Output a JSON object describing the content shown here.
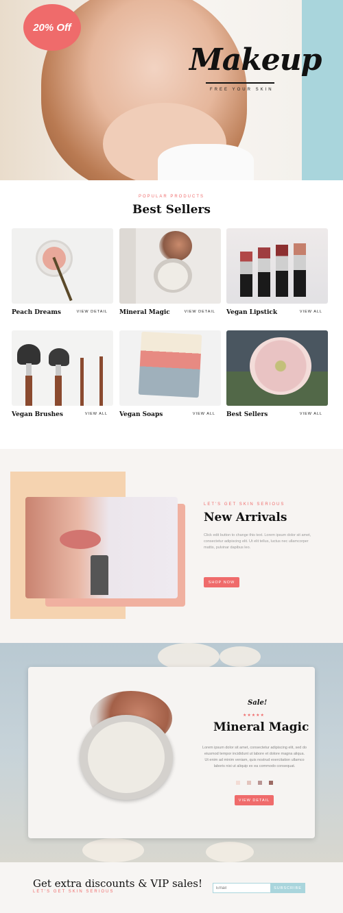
{
  "hero": {
    "badge": "20% Off",
    "logo": "Makeup",
    "tagline": "FREE YOUR SKIN"
  },
  "best_sellers": {
    "kicker": "POPULAR PRODUCTS",
    "title": "Best Sellers",
    "cards": [
      {
        "name": "Peach Dreams",
        "link": "VIEW DETAIL"
      },
      {
        "name": "Mineral Magic",
        "link": "VIEW DETAIL"
      },
      {
        "name": "Vegan Lipstick",
        "link": "VIEW ALL"
      },
      {
        "name": "Vegan Brushes",
        "link": "VIEW ALL"
      },
      {
        "name": "Vegan Soaps",
        "link": "VIEW ALL"
      },
      {
        "name": "Best Sellers",
        "link": "VIEW ALL"
      }
    ]
  },
  "new_arrivals": {
    "kicker": "LET'S GET SKIN SERIOUS",
    "title": "New Arrivals",
    "body": "Click edit button to change this text. Lorem ipsum dolor sit amet, consectetur adipiscing elit. Ut elit tellus, luctus nec ullamcorper mattis, pulvinar dapibus leo.",
    "button": "SHOP NOW"
  },
  "mineral_magic": {
    "sale": "Sale!",
    "stars": "★★★★★",
    "title": "Mineral Magic",
    "body": "Lorem ipsum dolor sit amet, consectetur adipiscing elit, sed do eiusmod tempor incididunt ut labore et dolore magna aliqua. Ut enim ad minim veniam, quis nostrud exercitation ullamco laboris nisi ut aliquip ex ea commodo consequat.",
    "swatch_colors": [
      "#f3dcd5",
      "#e3c4bd",
      "#b99593",
      "#9c6b64"
    ],
    "button": "VIEW DETAIL"
  },
  "footer": {
    "title": "Get extra discounts & VIP sales!",
    "kicker": "LET'S GET SKIN SERIOUS",
    "email_placeholder": "Email",
    "subscribe": "SUBSCRIBE"
  },
  "colors": {
    "accent": "#ef6b6b",
    "teal": "#a9d5dc"
  }
}
